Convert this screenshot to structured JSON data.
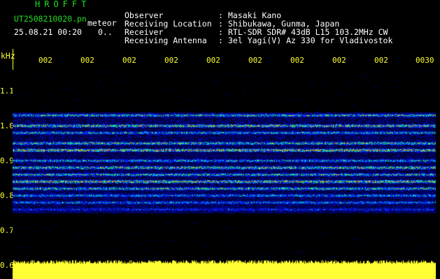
{
  "header": {
    "brand": "HROFFT",
    "filename": "UT2508210020.pn",
    "kind": "meteor",
    "datetime": "25.08.21 00:20",
    "extra": "0..",
    "info": [
      {
        "label": "Observer",
        "value": "Masaki Kano"
      },
      {
        "label": "Receiving Location",
        "value": "Shibukawa, Gunma, Japan"
      },
      {
        "label": "Receiver",
        "value": "RTL-SDR SDR# 43dB L15 103.2MHz CW"
      },
      {
        "label": "Receiving Antenna",
        "value": "3el Yagi(V) Az 330 for Vladivostok"
      }
    ]
  },
  "axis": {
    "unit": "kHz",
    "y_ticks": [
      "1.1",
      "1.0",
      "0.9",
      "0.8",
      "0.7",
      "0.6"
    ],
    "x_ticks": [
      "002",
      "002",
      "002",
      "002",
      "002",
      "002",
      "002",
      "002",
      "002",
      "0030"
    ]
  },
  "colors": {
    "text_green": "#22dd22",
    "axis_yellow": "#ffff33",
    "background": "#000000"
  },
  "spectrogram": {
    "freq_range_khz": [
      0.6,
      1.1
    ],
    "band_centers_khz": [
      1.03,
      1.0,
      0.98,
      0.95,
      0.93,
      0.9,
      0.88,
      0.86,
      0.84,
      0.82,
      0.8,
      0.78,
      0.76
    ],
    "band_strength": [
      0.7,
      0.9,
      0.6,
      0.8,
      1.0,
      0.6,
      0.85,
      0.7,
      0.95,
      0.75,
      0.55,
      0.5,
      0.3
    ],
    "baseline_amplitude_fraction": 0.6
  }
}
